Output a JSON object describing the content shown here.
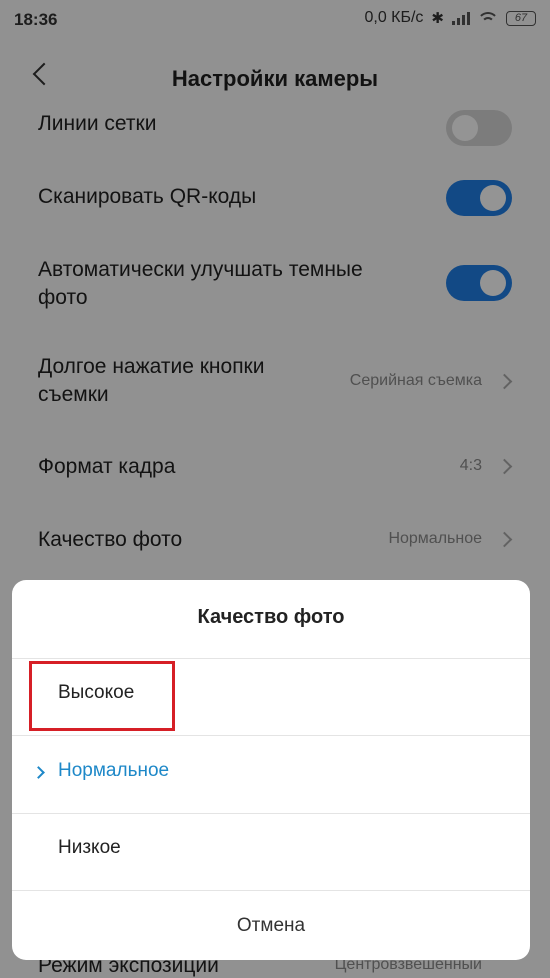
{
  "status_bar": {
    "time": "18:36",
    "network_speed": "0,0 КБ/с",
    "battery_level": "67",
    "icons": [
      "bluetooth-icon",
      "signal-icon",
      "wifi-icon",
      "battery-icon"
    ]
  },
  "header": {
    "title": "Настройки камеры",
    "back_icon": "back-arrow-icon"
  },
  "settings": {
    "grid_lines": {
      "label": "Линии сетки",
      "enabled": false
    },
    "scan_qr": {
      "label": "Сканировать QR-коды",
      "enabled": true
    },
    "enhance_dark": {
      "label_line1": "Автоматически улучшать темные",
      "label_line2": "фото",
      "enabled": true
    },
    "long_press": {
      "label_line1": "Долгое нажатие кнопки",
      "label_line2": "съемки",
      "value": "Серийная съемка"
    },
    "aspect_ratio": {
      "label": "Формат кадра",
      "value": "4:3"
    },
    "photo_quality": {
      "label": "Качество фото",
      "value": "Нормальное"
    },
    "exposure_mode": {
      "label": "Режим экспозиции",
      "value": "Центровзвешенный"
    }
  },
  "dialog": {
    "title": "Качество фото",
    "options": [
      {
        "label": "Высокое",
        "selected": false,
        "highlighted": true
      },
      {
        "label": "Нормальное",
        "selected": true,
        "highlighted": false
      },
      {
        "label": "Низкое",
        "selected": false,
        "highlighted": false
      }
    ],
    "cancel_label": "Отмена"
  },
  "colors": {
    "accent": "#1f7fe6",
    "selected_text": "#1e88c8",
    "highlight_border": "#d61f26"
  }
}
